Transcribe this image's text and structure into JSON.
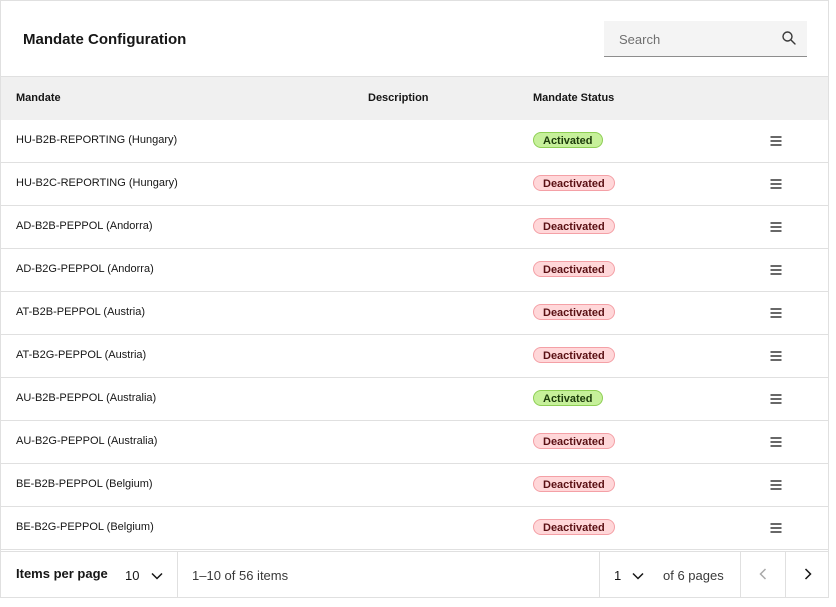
{
  "header": {
    "title": "Mandate Configuration",
    "search": {
      "placeholder": "Search",
      "icon": "search-icon"
    }
  },
  "table": {
    "columns": {
      "mandate": "Mandate",
      "description": "Description",
      "status": "Mandate Status"
    },
    "rows": [
      {
        "mandate": "HU-B2B-REPORTING (Hungary)",
        "description": "",
        "status": "Activated"
      },
      {
        "mandate": "HU-B2C-REPORTING (Hungary)",
        "description": "",
        "status": "Deactivated"
      },
      {
        "mandate": "AD-B2B-PEPPOL (Andorra)",
        "description": "",
        "status": "Deactivated"
      },
      {
        "mandate": "AD-B2G-PEPPOL (Andorra)",
        "description": "",
        "status": "Deactivated"
      },
      {
        "mandate": "AT-B2B-PEPPOL (Austria)",
        "description": "",
        "status": "Deactivated"
      },
      {
        "mandate": "AT-B2G-PEPPOL (Austria)",
        "description": "",
        "status": "Deactivated"
      },
      {
        "mandate": "AU-B2B-PEPPOL (Australia)",
        "description": "",
        "status": "Activated"
      },
      {
        "mandate": "AU-B2G-PEPPOL (Australia)",
        "description": "",
        "status": "Deactivated"
      },
      {
        "mandate": "BE-B2B-PEPPOL (Belgium)",
        "description": "",
        "status": "Deactivated"
      },
      {
        "mandate": "BE-B2G-PEPPOL (Belgium)",
        "description": "",
        "status": "Deactivated"
      }
    ],
    "row_action_icon": "overflow-menu-icon"
  },
  "pagination": {
    "items_per_page_label": "Items per page",
    "items_per_page": "10",
    "range_text": "1–10 of 56 items",
    "current_page": "1",
    "total_pages_text": "of 6 pages"
  },
  "colors": {
    "activated_bg": "#c6f09a",
    "deactivated_bg": "#ffd7d9",
    "header_bg": "#f0f0f0"
  }
}
